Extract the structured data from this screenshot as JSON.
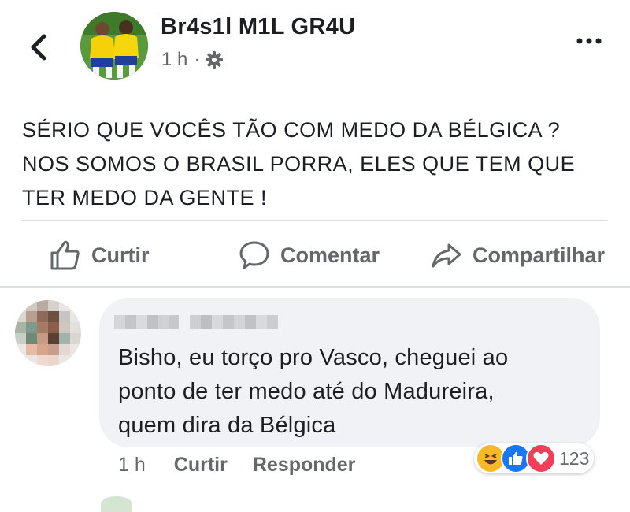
{
  "post": {
    "page_name": "Br4s1l M1L GR4U",
    "time": "1 h",
    "dot": "·",
    "text_lines": [
      "SÉRIO QUE VOCÊS TÃO COM MEDO DA BÉLGICA ?",
      "NOS SOMOS O BRASIL PORRA, ELES QUE TEM QUE",
      "TER MEDO DA GENTE !"
    ]
  },
  "actions": {
    "like": "Curtir",
    "comment": "Comentar",
    "share": "Compartilhar"
  },
  "comment": {
    "text_lines": [
      "Bisho, eu torço pro Vasco, cheguei ao",
      "ponto de ter medo até do Madureira,",
      "quem dira da Bélgica"
    ],
    "time": "1 h",
    "like": "Curtir",
    "reply": "Responder",
    "reaction_count": "123"
  },
  "icons": {
    "back": "chevron-left-icon",
    "more": "more-dots-icon",
    "privacy": "gear-icon",
    "like": "thumbs-up-icon",
    "comment": "speech-bubble-icon",
    "share": "share-arrow-icon"
  },
  "colors": {
    "text": "#1c1e21",
    "muted": "#65676b",
    "bubble": "#f0f2f5",
    "like_blue": "#1877f2",
    "love_red": "#f33e58",
    "haha_yellow": "#f7b928"
  }
}
